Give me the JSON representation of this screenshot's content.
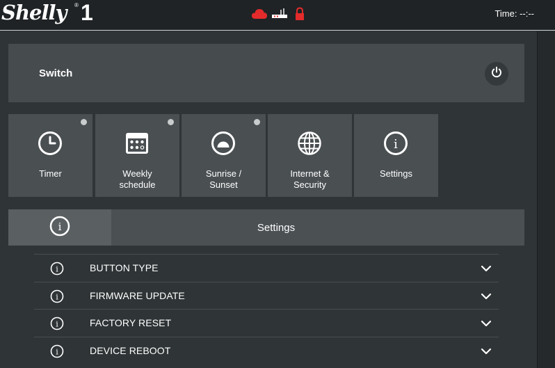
{
  "header": {
    "logo_text": "Shelly",
    "logo_model": "1",
    "logo_reg": "®",
    "status_icons": [
      "cloud-icon",
      "router-icon",
      "lock-icon"
    ],
    "time_text": "Time: --:--",
    "status_color": "#e32b2b"
  },
  "switch": {
    "label": "Switch",
    "power_icon": "power-icon"
  },
  "tiles": [
    {
      "label": "Timer",
      "icon": "clock-icon",
      "has_indicator": true
    },
    {
      "label": "Weekly\nschedule",
      "icon": "calendar-icon",
      "has_indicator": true
    },
    {
      "label": "Sunrise /\nSunset",
      "icon": "sunrise-icon",
      "has_indicator": true
    },
    {
      "label": "Internet &\nSecurity",
      "icon": "globe-icon",
      "has_indicator": false
    },
    {
      "label": "Settings",
      "icon": "info-icon",
      "has_indicator": false
    }
  ],
  "settings_tab": {
    "icon": "info-icon",
    "title": "Settings"
  },
  "settings_items": [
    {
      "label": "BUTTON TYPE",
      "icon": "info-icon",
      "expand_icon": "chevron-down-icon"
    },
    {
      "label": "FIRMWARE UPDATE",
      "icon": "info-icon",
      "expand_icon": "chevron-down-icon"
    },
    {
      "label": "FACTORY RESET",
      "icon": "info-icon",
      "expand_icon": "chevron-down-icon"
    },
    {
      "label": "DEVICE REBOOT",
      "icon": "info-icon",
      "expand_icon": "chevron-down-icon"
    }
  ]
}
